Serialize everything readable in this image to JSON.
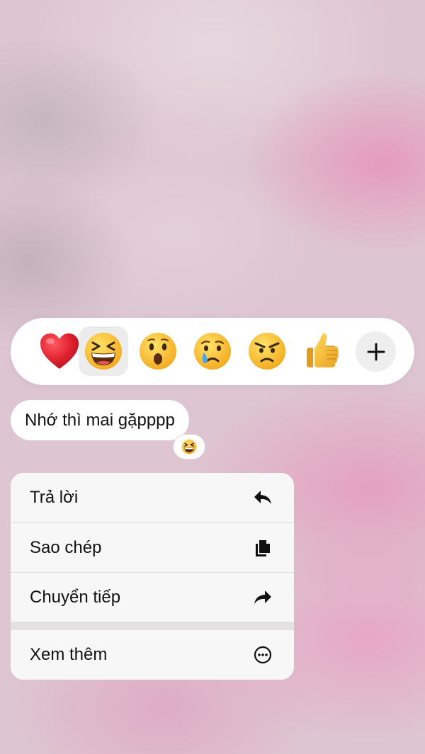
{
  "reactions": {
    "items": [
      {
        "emoji": "heart",
        "selected": false
      },
      {
        "emoji": "grinning-squinting-face",
        "selected": true
      },
      {
        "emoji": "surprised-face",
        "selected": false
      },
      {
        "emoji": "crying-face",
        "selected": false
      },
      {
        "emoji": "angry-face",
        "selected": false
      },
      {
        "emoji": "thumbs-up",
        "selected": false
      }
    ],
    "more_icon": "plus-icon"
  },
  "message": {
    "text": "Nhớ thì mai gặpppp",
    "reaction_badge": "grinning-squinting-face"
  },
  "menu": {
    "items": [
      {
        "label": "Trả lời",
        "icon": "reply-icon"
      },
      {
        "label": "Sao chép",
        "icon": "copy-icon"
      },
      {
        "label": "Chuyển tiếp",
        "icon": "forward-icon"
      },
      {
        "label": "Xem thêm",
        "icon": "more-icon"
      }
    ]
  },
  "colors": {
    "heart": "#e0212f",
    "emoji_face": "#fbc93a",
    "bubble_bg": "#ffffff",
    "menu_bg": "#f7f7f7"
  }
}
